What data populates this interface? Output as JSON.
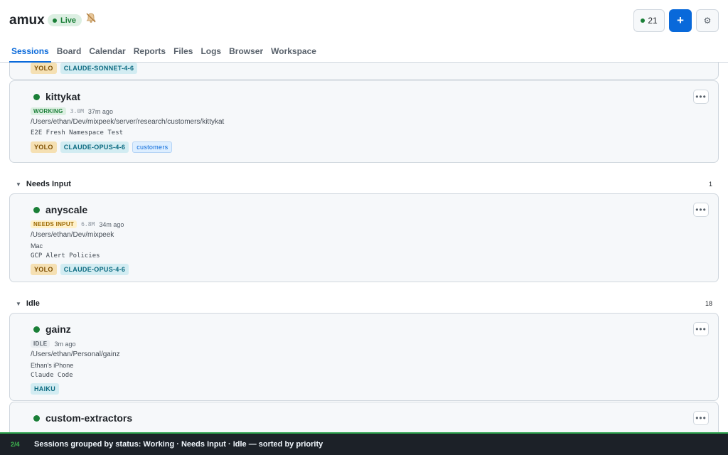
{
  "app": {
    "title": "amux",
    "live_label": "Live"
  },
  "header": {
    "session_count": "21",
    "add_label": "+",
    "settings_label": "⚙"
  },
  "nav": {
    "tabs": [
      {
        "label": "Sessions",
        "active": true
      },
      {
        "label": "Board"
      },
      {
        "label": "Calendar"
      },
      {
        "label": "Reports"
      },
      {
        "label": "Files"
      },
      {
        "label": "Logs"
      },
      {
        "label": "Browser"
      },
      {
        "label": "Workspace"
      }
    ]
  },
  "sessions": {
    "top_partial": {
      "tags": [
        "YOLO",
        "CLAUDE-SONNET-4-6"
      ]
    },
    "working": [
      {
        "name": "kittykat",
        "status": "WORKING",
        "size": "3.0M",
        "age": "37m ago",
        "path": "/Users/ethan/Dev/mixpeek/server/research/customers/kittykat",
        "description": "E2E Fresh Namespace Test",
        "tags": [
          "YOLO",
          "CLAUDE-OPUS-4-6"
        ],
        "group": "customers"
      }
    ],
    "needs_input_section": {
      "label": "Needs Input",
      "count": "1"
    },
    "needs_input": [
      {
        "name": "anyscale",
        "status": "NEEDS INPUT",
        "size": "6.8M",
        "age": "34m ago",
        "path": "/Users/ethan/Dev/mixpeek",
        "device": "Mac",
        "description": "GCP Alert Policies",
        "tags": [
          "YOLO",
          "CLAUDE-OPUS-4-6"
        ]
      }
    ],
    "idle_section": {
      "label": "Idle",
      "count": "18"
    },
    "idle": [
      {
        "name": "gainz",
        "status": "IDLE",
        "age": "3m ago",
        "path": "/Users/ethan/Personal/gainz",
        "device": "Ethan's iPhone",
        "description": "Claude Code",
        "tags": [
          "HAIKU"
        ]
      },
      {
        "name": "custom-extractors"
      }
    ]
  },
  "footer": {
    "step": "2/4",
    "hint": "Sessions grouped by status: Working · Needs Input · Idle — sorted by priority"
  },
  "colors": {
    "accent": "#0969da",
    "live": "#1a7f37",
    "footer_bg": "#1c2128"
  }
}
